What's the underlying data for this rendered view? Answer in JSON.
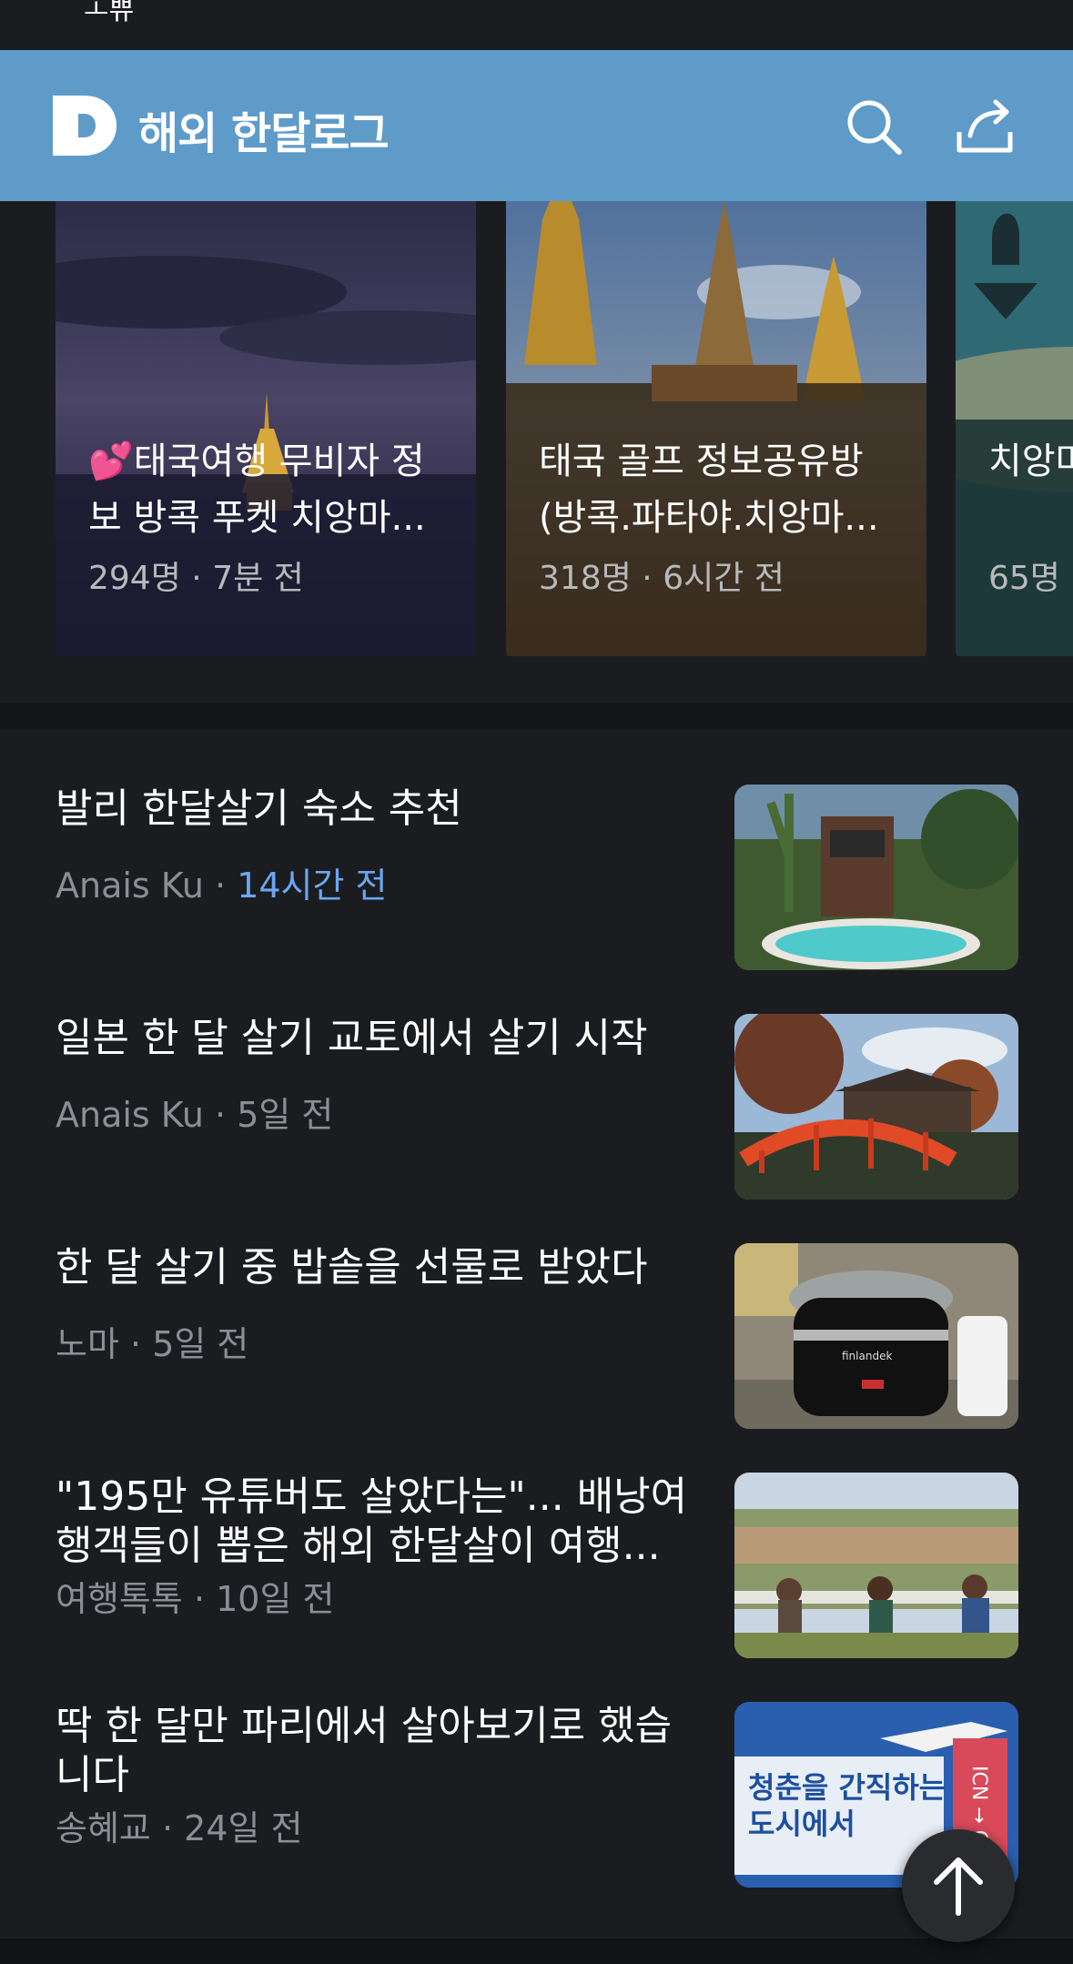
{
  "app": {
    "title": "해외 한달로그",
    "brand_color": "#5f9bc8"
  },
  "status": {
    "sliver": "ㅗ쀼"
  },
  "cards": [
    {
      "title": "💕태국여행 무비자 정보 방콕 푸켓 치앙마...",
      "members": "294명",
      "time": "7분 전"
    },
    {
      "title": "태국 골프 정보공유방(방콕.파타야.치앙마...",
      "members": "318명",
      "time": "6시간 전"
    },
    {
      "title": "치앙마(치.도",
      "members": "65명",
      "time": ""
    }
  ],
  "feed": [
    {
      "title": "발리 한달살기 숙소 추천",
      "author": "Anais Ku",
      "time": "14시간 전"
    },
    {
      "title": "일본 한 달 살기 교토에서 살기 시작",
      "author": "Anais Ku",
      "time": "5일 전"
    },
    {
      "title": "한 달 살기 중 밥솥을 선물로 받았다",
      "author": "노마",
      "time": "5일 전"
    },
    {
      "title": "\"195만 유튜버도 살았다는\"... 배낭여행객들이 뽑은 해외 한달살이 여행...",
      "author": "여행톡톡",
      "time": "10일 전"
    },
    {
      "title": "딱 한 달만 파리에서 살아보기로 했습니다",
      "author": "송혜교",
      "time": "24일 전"
    }
  ],
  "thumb_text": {
    "poster": "청춘을 간직하는\n도시에서",
    "ticket": "ICN → CD",
    "brand": "finlandek"
  },
  "separator": "·",
  "icons": [
    "app-logo-icon",
    "search-icon",
    "share-icon",
    "arrow-up-icon"
  ]
}
